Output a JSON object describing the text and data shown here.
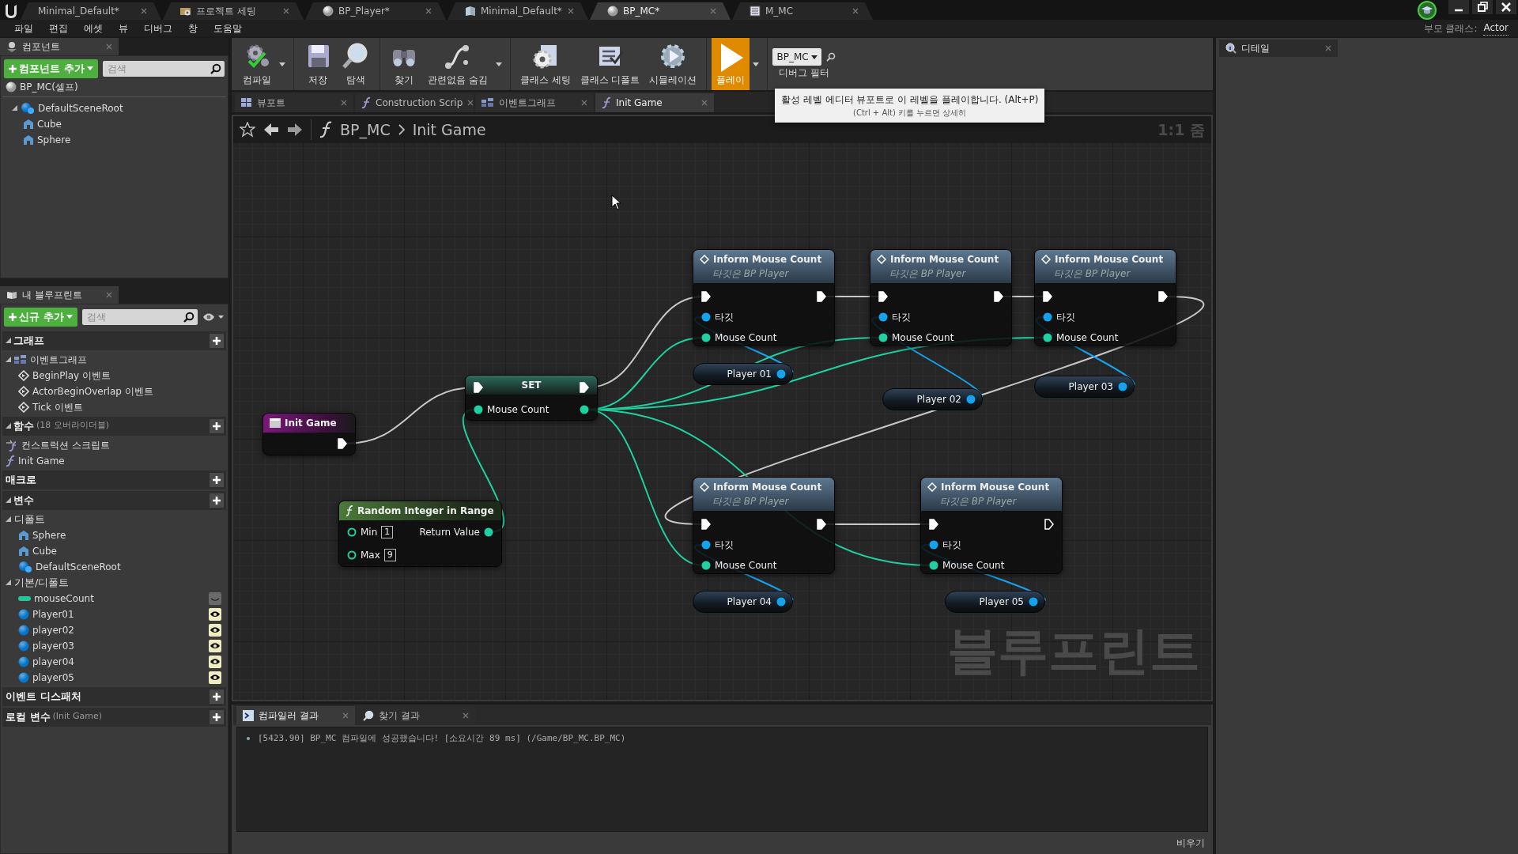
{
  "editor_tabs": [
    {
      "label": "Minimal_Default*",
      "kind": "plain",
      "selected": false
    },
    {
      "label": "프로젝트 세팅",
      "kind": "settings",
      "selected": false
    },
    {
      "label": "BP_Player*",
      "kind": "blueprint",
      "selected": false
    },
    {
      "label": "Minimal_Default*",
      "kind": "level",
      "selected": false
    },
    {
      "label": "BP_MC*",
      "kind": "blueprint",
      "selected": true
    },
    {
      "label": "M_MC",
      "kind": "material",
      "selected": false
    }
  ],
  "menu": [
    "파일",
    "편집",
    "에셋",
    "뷰",
    "디버그",
    "창",
    "도움말"
  ],
  "parent_class": {
    "label": "부모 클래스:",
    "value": "Actor"
  },
  "components_panel": {
    "title": "컴포넌트",
    "add_button": "컴포넌트 추가",
    "search_placeholder": "검색",
    "self": "BP_MC(셀프)",
    "tree": [
      {
        "label": "DefaultSceneRoot",
        "kind": "scene",
        "expanded": true,
        "children": [
          {
            "label": "Cube",
            "kind": "mesh"
          },
          {
            "label": "Sphere",
            "kind": "mesh"
          }
        ]
      }
    ]
  },
  "my_blueprint": {
    "title": "내 블루프린트",
    "add_button": "신규 추가",
    "search_placeholder": "검색",
    "sections": [
      {
        "title": "그래프",
        "add": true,
        "expanded": true,
        "items": [
          {
            "kind": "graph",
            "label": "이벤트그래프",
            "expanded": true,
            "children": [
              {
                "kind": "event",
                "label": "BeginPlay 이벤트"
              },
              {
                "kind": "event",
                "label": "ActorBeginOverlap 이벤트"
              },
              {
                "kind": "event",
                "label": "Tick 이벤트"
              }
            ]
          }
        ]
      },
      {
        "title": "함수",
        "note": "(18 오버라이더블)",
        "add": true,
        "expanded": true,
        "items": [
          {
            "kind": "construction",
            "label": "컨스트럭션 스크립트"
          },
          {
            "kind": "function",
            "label": "Init Game"
          }
        ]
      },
      {
        "title": "매크로",
        "add": true
      },
      {
        "title": "변수",
        "add": true,
        "expanded": true,
        "items": [
          {
            "kind": "category",
            "label": "디폴트",
            "expanded": true,
            "children": [
              {
                "kind": "mesh",
                "label": "Sphere"
              },
              {
                "kind": "mesh",
                "label": "Cube"
              },
              {
                "kind": "scene",
                "label": "DefaultSceneRoot"
              }
            ]
          },
          {
            "kind": "category",
            "label": "기본/디폴트",
            "expanded": true,
            "children": [
              {
                "kind": "int",
                "label": "mouseCount",
                "exposed": false
              },
              {
                "kind": "object",
                "label": "Player01",
                "exposed": true
              },
              {
                "kind": "object",
                "label": "player02",
                "exposed": true
              },
              {
                "kind": "object",
                "label": "player03",
                "exposed": true
              },
              {
                "kind": "object",
                "label": "player04",
                "exposed": true
              },
              {
                "kind": "object",
                "label": "player05",
                "exposed": true
              }
            ]
          }
        ]
      },
      {
        "title": "이벤트 디스패처",
        "add": true
      },
      {
        "title": "로컬 변수",
        "note": "(Init Game)",
        "add": true
      }
    ]
  },
  "toolbar": [
    [
      {
        "label": "컴파일",
        "kind": "compile",
        "menu": true,
        "highlighted": false
      }
    ],
    [
      {
        "label": "저장",
        "kind": "save",
        "menu": false,
        "highlighted": false
      },
      {
        "label": "탐색",
        "kind": "browse",
        "menu": false,
        "highlighted": false
      }
    ],
    [
      {
        "label": "찾기",
        "kind": "find",
        "menu": false,
        "highlighted": false
      },
      {
        "label": "관련없음 숨김",
        "kind": "hide",
        "menu": true,
        "highlighted": false
      }
    ],
    [
      {
        "label": "클래스 세팅",
        "kind": "class-settings",
        "menu": false,
        "highlighted": false
      },
      {
        "label": "클래스 디폴트",
        "kind": "class-defaults",
        "menu": false,
        "highlighted": false
      },
      {
        "label": "시뮬레이션",
        "kind": "simulate",
        "menu": false,
        "highlighted": false
      }
    ],
    [
      {
        "label": "플레이",
        "kind": "play",
        "menu": true,
        "highlighted": true
      }
    ]
  ],
  "debug_filter": {
    "value": "BP_MC",
    "label": "디버그 필터"
  },
  "tooltip": {
    "text": "활성 레벨 에디터 뷰포트로 이 레벨을 플레이합니다. (Alt+P)",
    "hint": "(Ctrl + Alt) 키를 누르면 상세히"
  },
  "document_tabs": [
    {
      "label": "뷰포트",
      "kind": "viewport",
      "selected": false
    },
    {
      "label": "Construction Scrip",
      "kind": "function",
      "selected": false
    },
    {
      "label": "이벤트그래프",
      "kind": "graph",
      "selected": false
    },
    {
      "label": "Init Game",
      "kind": "function",
      "selected": true
    }
  ],
  "graph": {
    "breadcrumb": [
      "BP_MC",
      "Init Game"
    ],
    "zoom": "1:1 줌",
    "watermark": "블루프린트",
    "nodes": [
      {
        "kind": "entry",
        "title": "Init Game"
      },
      {
        "kind": "set",
        "title": "SET",
        "pin": "Mouse Count"
      },
      {
        "kind": "pure",
        "title": "Random Integer in Range",
        "inputs": [
          {
            "label": "Min",
            "value": "1"
          },
          {
            "label": "Max",
            "value": "9"
          }
        ],
        "output": "Return Value"
      },
      {
        "kind": "call",
        "title": "Inform Mouse Count",
        "subtitle": "타깃은 BP Player",
        "pins": [
          "타깃",
          "Mouse Count"
        ],
        "exec_out_connected": true
      },
      {
        "kind": "call",
        "title": "Inform Mouse Count",
        "subtitle": "타깃은 BP Player",
        "pins": [
          "타깃",
          "Mouse Count"
        ],
        "exec_out_connected": true
      },
      {
        "kind": "call",
        "title": "Inform Mouse Count",
        "subtitle": "타깃은 BP Player",
        "pins": [
          "타깃",
          "Mouse Count"
        ],
        "exec_out_connected": true
      },
      {
        "kind": "call",
        "title": "Inform Mouse Count",
        "subtitle": "타깃은 BP Player",
        "pins": [
          "타깃",
          "Mouse Count"
        ],
        "exec_out_connected": true
      },
      {
        "kind": "call",
        "title": "Inform Mouse Count",
        "subtitle": "타깃은 BP Player",
        "pins": [
          "타깃",
          "Mouse Count"
        ],
        "exec_out_connected": false
      },
      {
        "kind": "getter",
        "label": "Player 01"
      },
      {
        "kind": "getter",
        "label": "Player 02"
      },
      {
        "kind": "getter",
        "label": "Player 03"
      },
      {
        "kind": "getter",
        "label": "Player 04"
      },
      {
        "kind": "getter",
        "label": "Player 05"
      }
    ]
  },
  "output_tabs": [
    {
      "label": "컴파일러 결과",
      "kind": "compiler",
      "selected": true
    },
    {
      "label": "찾기 결과",
      "kind": "find",
      "selected": false
    }
  ],
  "log": [
    "[5423.90] BP_MC 컴파일에 성공했습니다! [소요시간 89 ms] (/Game/BP_MC.BP_MC)"
  ],
  "clear_button": "비우기",
  "details_panel": {
    "title": "디테일"
  }
}
